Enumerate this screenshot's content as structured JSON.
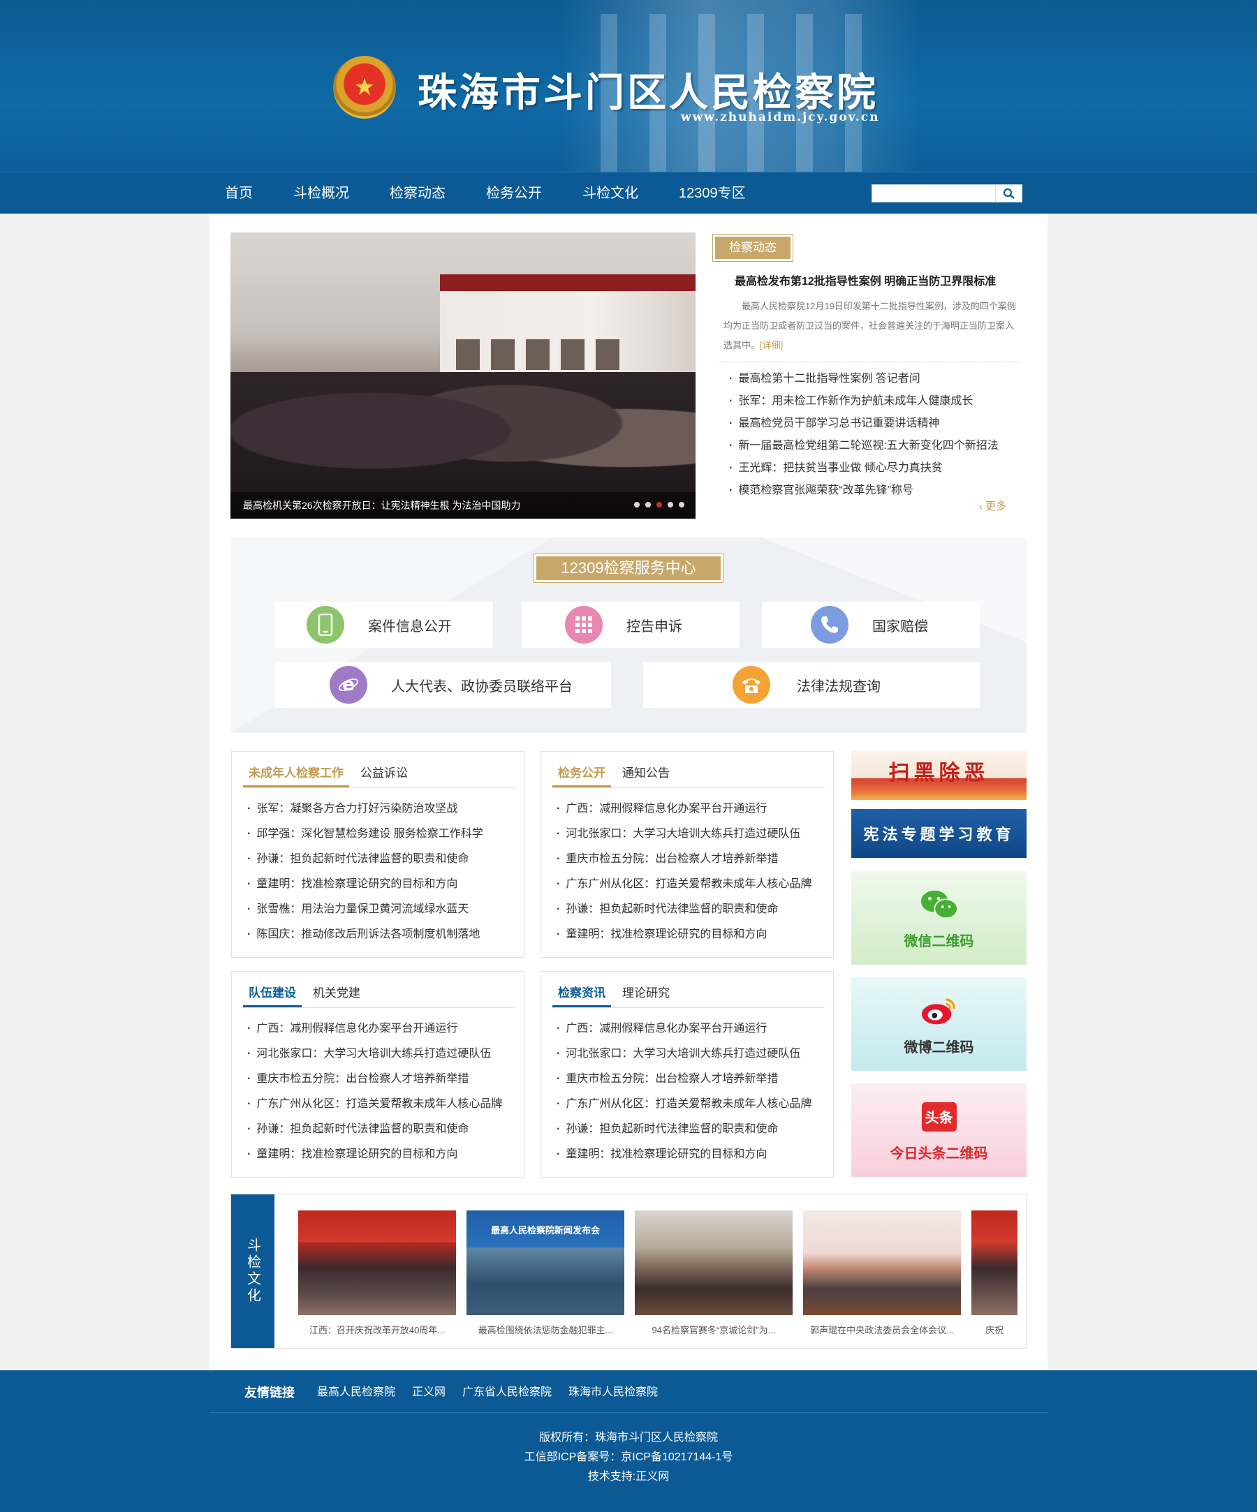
{
  "header": {
    "title": "珠海市斗门区人民检察院",
    "url": "www.zhuhaidm.jcy.gov.cn"
  },
  "nav": {
    "items": [
      "首页",
      "斗检概况",
      "检察动态",
      "检务公开",
      "斗检文化",
      "12309专区"
    ],
    "search_value": ""
  },
  "slideshow": {
    "caption": "最高检机关第26次检察开放日：让宪法精神生根 为法治中国助力",
    "dot_count": 5,
    "active_dot": 3
  },
  "news": {
    "tag": "检察动态",
    "headline": "最高检发布第12批指导性案例 明确正当防卫界限标准",
    "summary": "最高人民检察院12月19日印发第十二批指导性案例，涉及的四个案例均为正当防卫或者防卫过当的案件，社会普遍关注的于海明正当防卫案入选其中。",
    "detail_link": "[详细]",
    "items": [
      "最高检第十二批指导性案例 答记者问",
      "张军：用未检工作新作为护航未成年人健康成长",
      "最高检党员干部学习总书记重要讲话精神",
      "新一届最高检党组第二轮巡视:五大新变化四个新招法",
      "王光辉：把扶贫当事业做 倾心尽力真扶贫",
      "模范检察官张飚荣获“改革先锋”称号"
    ],
    "more": "更多"
  },
  "services": {
    "title": "12309检察服务中心",
    "items": [
      {
        "label": "案件信息公开",
        "color": "#8cc56b"
      },
      {
        "label": "控告申诉",
        "color": "#e887b2"
      },
      {
        "label": "国家赔偿",
        "color": "#7b9de0"
      },
      {
        "label": "人大代表、政协委员联络平台",
        "color": "#a07bc5"
      },
      {
        "label": "法律法规查询",
        "color": "#f3a333"
      }
    ]
  },
  "boxes": [
    {
      "tabs": [
        "未成年人检察工作",
        "公益诉讼"
      ],
      "style": "gold",
      "items": [
        "张军：凝聚各方合力打好污染防治攻坚战",
        "邱学强：深化智慧检务建设 服务检察工作科学",
        "孙谦：担负起新时代法律监督的职责和使命",
        "童建明：找准检察理论研究的目标和方向",
        "张雪樵：用法治力量保卫黄河流域绿水蓝天",
        "陈国庆：推动修改后刑诉法各项制度机制落地"
      ]
    },
    {
      "tabs": [
        "检务公开",
        "通知公告"
      ],
      "style": "gold",
      "items": [
        "广西：减刑假释信息化办案平台开通运行",
        "河北张家口：大学习大培训大练兵打造过硬队伍",
        "重庆市检五分院：出台检察人才培养新举措",
        "广东广州从化区：打造关爱帮教未成年人核心品牌",
        "孙谦：担负起新时代法律监督的职责和使命",
        "童建明：找准检察理论研究的目标和方向"
      ]
    },
    {
      "tabs": [
        "队伍建设",
        "机关党建"
      ],
      "style": "blue",
      "items": [
        "广西：减刑假释信息化办案平台开通运行",
        "河北张家口：大学习大培训大练兵打造过硬队伍",
        "重庆市检五分院：出台检察人才培养新举措",
        "广东广州从化区：打造关爱帮教未成年人核心品牌",
        "孙谦：担负起新时代法律监督的职责和使命",
        "童建明：找准检察理论研究的目标和方向"
      ]
    },
    {
      "tabs": [
        "检察资讯",
        "理论研究"
      ],
      "style": "blue",
      "items": [
        "广西：减刑假释信息化办案平台开通运行",
        "河北张家口：大学习大培训大练兵打造过硬队伍",
        "重庆市检五分院：出台检察人才培养新举措",
        "广东广州从化区：打造关爱帮教未成年人核心品牌",
        "孙谦：担负起新时代法律监督的职责和使命",
        "童建明：找准检察理论研究的目标和方向"
      ]
    }
  ],
  "banners": {
    "saohei": "扫黑除恶",
    "xianfa": "宪法专题学习教育",
    "wechat": "微信二维码",
    "weibo": "微博二维码",
    "toutiao_icon": "头条",
    "toutiao": "今日头条二维码"
  },
  "culture": {
    "label": "斗检文化",
    "items": [
      {
        "caption": "江西：召开庆祝改革开放40周年..."
      },
      {
        "caption": "最高检围绕依法惩防金融犯罪主...",
        "banner": "最高人民检察院新闻发布会"
      },
      {
        "caption": "94名检察官赛冬“京城论剑”为..."
      },
      {
        "caption": "郭声琨在中央政法委员会全体会议..."
      },
      {
        "caption": "庆祝"
      }
    ]
  },
  "footer": {
    "links_title": "友情链接",
    "links": [
      "最高人民检察院",
      "正义网",
      "广东省人民检察院",
      "珠海市人民检察院"
    ],
    "copyright": "版权所有：珠海市斗门区人民检察院",
    "icp": "工信部ICP备案号：京ICP备10217144-1号",
    "tech": "技术支持:正义网"
  }
}
